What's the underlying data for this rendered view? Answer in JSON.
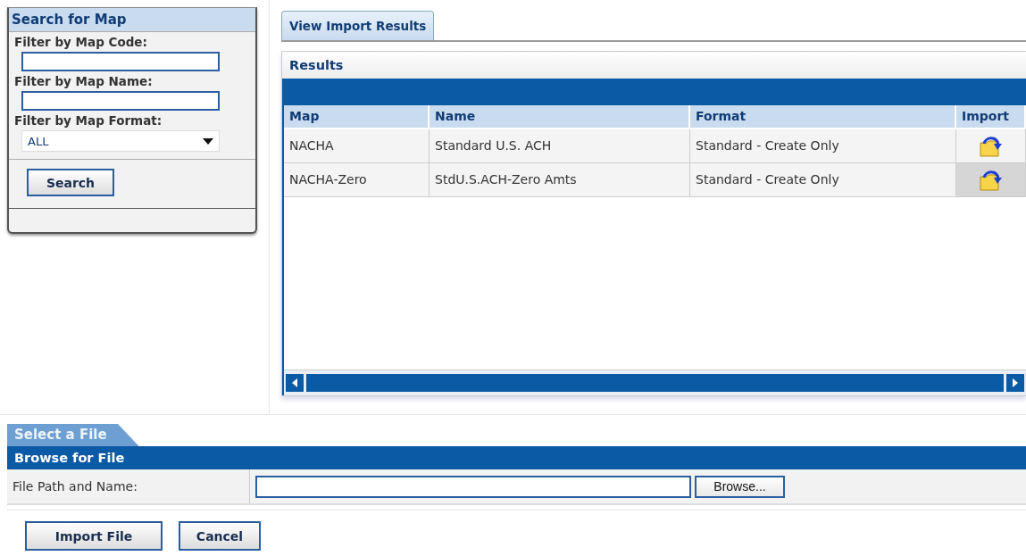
{
  "search_panel": {
    "title": "Search for Map",
    "fields": [
      {
        "kind": "text",
        "label": "Filter by Map Code:"
      },
      {
        "kind": "text",
        "label": "Filter by Map Name:"
      },
      {
        "kind": "select",
        "label": "Filter by Map Format:",
        "value": "ALL"
      }
    ],
    "button": "Search"
  },
  "tabs": [
    {
      "label": "View Import Results",
      "selected": true
    }
  ],
  "results": {
    "title": "Results",
    "columns": [
      "Map",
      "Name",
      "Format",
      "Import"
    ],
    "rows": [
      {
        "map": "NACHA",
        "name": "Standard U.S. ACH",
        "format": "Standard - Create Only",
        "hovered": false
      },
      {
        "map": "NACHA-Zero",
        "name": "StdU.S.ACH-Zero Amts",
        "format": "Standard - Create Only",
        "hovered": true
      }
    ]
  },
  "file_section": {
    "tab": "Select a File",
    "header": "Browse for File",
    "label": "File Path and Name:",
    "browse_button": "Browse..."
  },
  "buttons": [
    "Import File",
    "Cancel"
  ]
}
